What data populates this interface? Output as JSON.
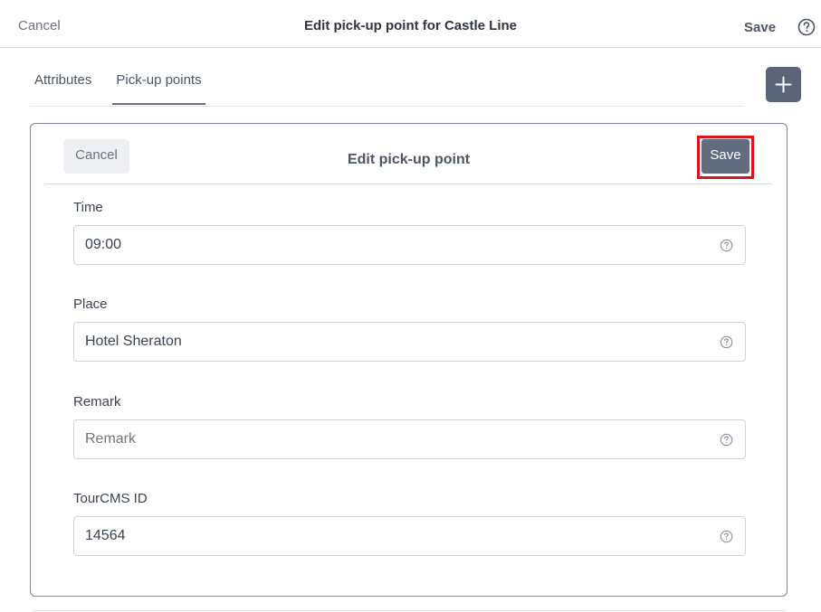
{
  "topbar": {
    "cancel_label": "Cancel",
    "title": "Edit pick-up point for Castle Line",
    "save_label": "Save",
    "help_icon": "help-circle-icon"
  },
  "tabs": [
    {
      "label": "Attributes",
      "active": false
    },
    {
      "label": "Pick-up points",
      "active": true
    }
  ],
  "add_button": {
    "icon": "plus-icon"
  },
  "panel": {
    "title": "Edit pick-up point",
    "cancel_label": "Cancel",
    "save_label": "Save",
    "fields": [
      {
        "label": "Time",
        "value": "09:00",
        "placeholder": ""
      },
      {
        "label": "Place",
        "value": "Hotel Sheraton",
        "placeholder": ""
      },
      {
        "label": "Remark",
        "value": "",
        "placeholder": "Remark"
      },
      {
        "label": "TourCMS ID",
        "value": "14564",
        "placeholder": ""
      }
    ]
  },
  "colors": {
    "highlight": "#e0121b",
    "primary_button": "#616c7f",
    "add_button": "#5a6578"
  }
}
